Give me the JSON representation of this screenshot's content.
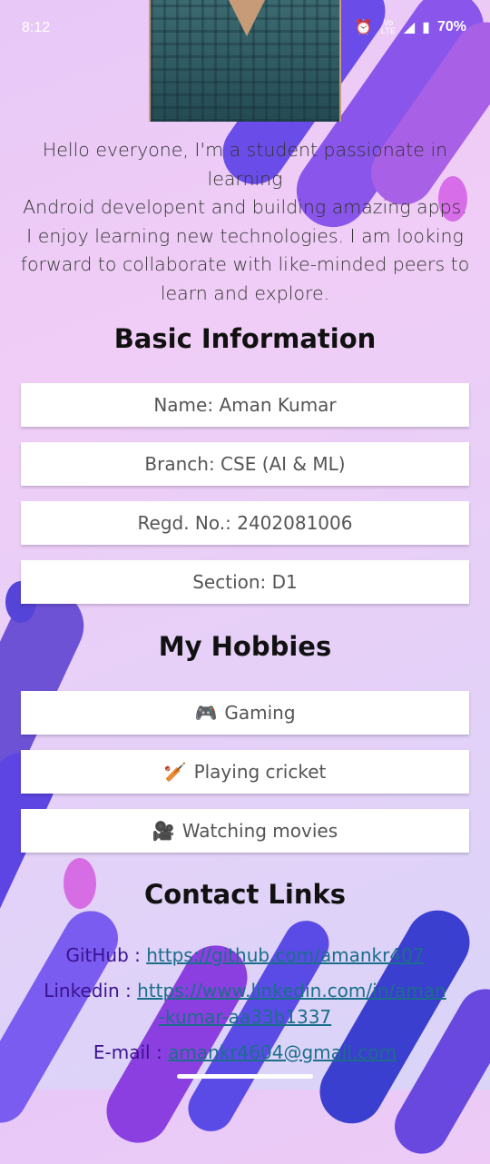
{
  "status_bar": {
    "time": "8:12",
    "icons": [
      "alarm-icon",
      "volte-icon",
      "signal-icon",
      "battery-icon"
    ],
    "network_label": "Vo LTE",
    "battery": "70%"
  },
  "profile": {
    "bio": "Hello everyone, I'm a student passionate in learning\nAndroid developent and building amazing apps.\nI enjoy learning new technologies. I am looking\nforward to collaborate with like-minded peers to\nlearn and explore."
  },
  "basic_info": {
    "title": "Basic Information",
    "items": [
      "Name: Aman Kumar",
      "Branch: CSE (AI & ML)",
      "Regd. No.: 2402081006",
      "Section: D1"
    ]
  },
  "hobbies": {
    "title": "My Hobbies",
    "items": [
      {
        "emoji": "🎮",
        "label": "Gaming"
      },
      {
        "emoji": "🏏",
        "label": "Playing cricket"
      },
      {
        "emoji": "🎥",
        "label": "Watching movies"
      }
    ]
  },
  "contacts": {
    "title": "Contact Links",
    "github_label": "GitHub : ",
    "github_url": "https://github.com/amankr407",
    "linkedin_label": "Linkedin : ",
    "linkedin_url_line1": "https://www.linkedin.com/in/aman",
    "linkedin_url_line2": "-kumar-aa33b1337",
    "email_label": "E-mail : ",
    "email": "amankr4604@gmail.com"
  },
  "colors": {
    "accent_purple": "#7b3fe4",
    "link": "#1a6e8a",
    "label": "#3a1290"
  }
}
